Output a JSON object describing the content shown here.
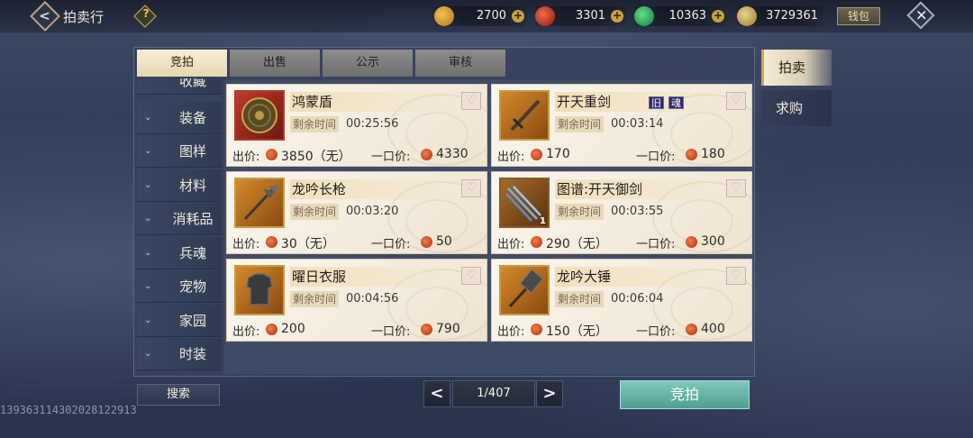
{
  "header": {
    "title": "拍卖行",
    "back_icon": "back-arrow-icon",
    "help_label": "?",
    "wallet_label": "钱包",
    "close_label": "✕"
  },
  "currencies": [
    {
      "name": "gold-ingot",
      "value": "2700",
      "color": "#d99a2a"
    },
    {
      "name": "red-coin",
      "value": "3301",
      "color": "#c0392b"
    },
    {
      "name": "jade-coin",
      "value": "10363",
      "color": "#2aa45a"
    },
    {
      "name": "silver-leaf",
      "value": "3729361",
      "color": "#c9a24a"
    }
  ],
  "tabs": [
    "竞拍",
    "出售",
    "公示",
    "审核"
  ],
  "sidebar": {
    "items": [
      {
        "label": "收藏"
      },
      {
        "label": "装备"
      },
      {
        "label": "图样"
      },
      {
        "label": "材料"
      },
      {
        "label": "消耗品"
      },
      {
        "label": "兵魂"
      },
      {
        "label": "宠物"
      },
      {
        "label": "家园"
      },
      {
        "label": "时装"
      }
    ]
  },
  "items": [
    {
      "name": "鸿蒙盾",
      "remain_label": "剩余时间",
      "remain": "00:25:56",
      "bid_label": "出价:",
      "bid": "3850（无）",
      "buy_label": "一口价:",
      "buy": "4330",
      "tags": []
    },
    {
      "name": "开天重剑",
      "remain_label": "剩余时间",
      "remain": "00:03:14",
      "bid_label": "出价:",
      "bid": "170",
      "buy_label": "一口价:",
      "buy": "180",
      "tags": [
        "旧",
        "魂"
      ]
    },
    {
      "name": "龙吟长枪",
      "remain_label": "剩余时间",
      "remain": "00:03:20",
      "bid_label": "出价:",
      "bid": "30（无）",
      "buy_label": "一口价:",
      "buy": "50",
      "tags": []
    },
    {
      "name": "图谱:开天御剑",
      "remain_label": "剩余时间",
      "remain": "00:03:55",
      "bid_label": "出价:",
      "bid": "290（无）",
      "buy_label": "一口价:",
      "buy": "300",
      "tags": [],
      "count": "1"
    },
    {
      "name": "曜日衣服",
      "remain_label": "剩余时间",
      "remain": "00:04:56",
      "bid_label": "出价:",
      "bid": "200",
      "buy_label": "一口价:",
      "buy": "790",
      "tags": []
    },
    {
      "name": "龙吟大锤",
      "remain_label": "剩余时间",
      "remain": "00:06:04",
      "bid_label": "出价:",
      "bid": "150（无）",
      "buy_label": "一口价:",
      "buy": "400",
      "tags": []
    }
  ],
  "footer": {
    "search_label": "搜索",
    "page": "1/407",
    "bid_button": "竞拍"
  },
  "right_tabs": [
    "拍卖",
    "求购"
  ],
  "watermark": "13936311430202812291З"
}
